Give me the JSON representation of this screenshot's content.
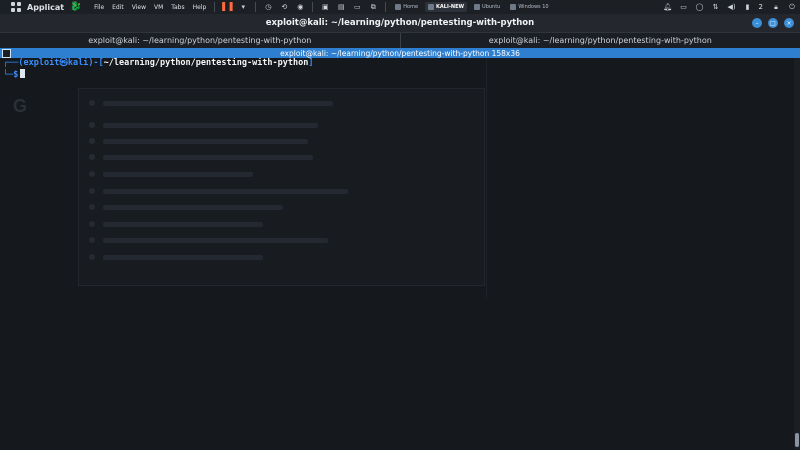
{
  "topbar": {
    "apps_label": "Applicat",
    "menu": [
      "File",
      "Edit",
      "View",
      "VM",
      "Tabs",
      "Help"
    ],
    "tabs": [
      {
        "label": "Home",
        "active": false
      },
      {
        "label": "KALI-NEW",
        "active": true
      },
      {
        "label": "Ubuntu",
        "active": false
      },
      {
        "label": "Windows 10",
        "active": false
      }
    ],
    "time": "2",
    "icons": [
      "apps-grid-icon",
      "kali-dragon-icon",
      "pause-icon",
      "record-icon",
      "bell-icon",
      "display-icon",
      "chat-icon",
      "network-icon",
      "volume-icon",
      "battery-icon",
      "lock-icon",
      "power-icon"
    ]
  },
  "titlebar": {
    "title": "exploit@kali: ~/learning/python/pentesting-with-python"
  },
  "terminal_tabs": [
    {
      "label": "exploit@kali: ~/learning/python/pentesting-with-python"
    },
    {
      "label": "exploit@kali: ~/learning/python/pentesting-with-python"
    }
  ],
  "active_terminal": {
    "header": "exploit@kali: ~/learning/python/pentesting-with-python 158x36"
  },
  "prompt": {
    "line1_open": "┌──(",
    "user": "exploit",
    "at": "㉿",
    "host": "kali",
    "line1_close": ")-[",
    "path": "~/learning/python/pentesting-with-python",
    "line1_end": "]",
    "line2": "└─",
    "dollar": "$"
  },
  "colors": {
    "accent": "#2f7fd0",
    "terminal_bg": "#15181d",
    "prompt_blue": "#3b8fff"
  }
}
